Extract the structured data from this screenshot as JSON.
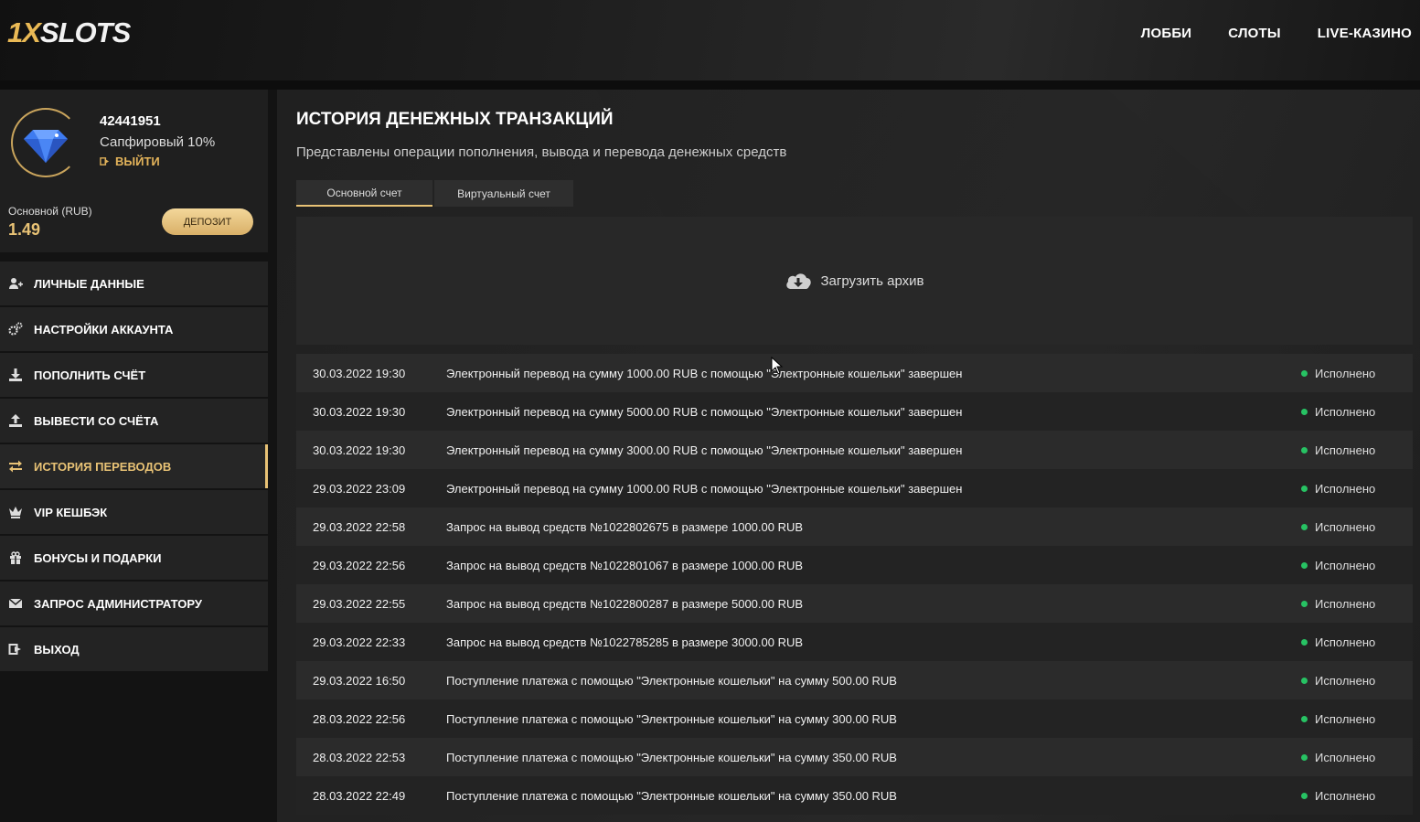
{
  "header": {
    "logo_part1": "1X",
    "logo_part2": "SLOTS",
    "nav": [
      "ЛОББИ",
      "СЛОТЫ",
      "LIVE-КАЗИНО"
    ]
  },
  "profile": {
    "user_id": "42441951",
    "level": "Сапфировый 10%",
    "logout": "ВЫЙТИ",
    "balance_label": "Основной (RUB)",
    "balance_value": "1.49",
    "deposit_label": "ДЕПОЗИТ"
  },
  "menu": [
    {
      "label": "ЛИЧНЫЕ ДАННЫЕ",
      "icon": "user-icon"
    },
    {
      "label": "НАСТРОЙКИ АККАУНТА",
      "icon": "gears-icon"
    },
    {
      "label": "ПОПОЛНИТЬ СЧЁТ",
      "icon": "download-icon"
    },
    {
      "label": "ВЫВЕСТИ СО СЧЁТА",
      "icon": "upload-icon"
    },
    {
      "label": "ИСТОРИЯ ПЕРЕВОДОВ",
      "icon": "transfer-icon",
      "active": true
    },
    {
      "label": "VIP КЕШБЭК",
      "icon": "crown-icon"
    },
    {
      "label": "БОНУСЫ И ПОДАРКИ",
      "icon": "gift-icon"
    },
    {
      "label": "ЗАПРОС АДМИНИСТРАТОРУ",
      "icon": "envelope-icon"
    },
    {
      "label": "ВЫХОД",
      "icon": "exit-icon"
    }
  ],
  "main": {
    "title": "ИСТОРИЯ ДЕНЕЖНЫХ ТРАНЗАКЦИЙ",
    "subtitle": "Представлены операции пополнения, вывода и перевода денежных средств",
    "tabs": [
      "Основной счет",
      "Виртуальный счет"
    ],
    "archive_label": "Загрузить архив"
  },
  "transactions": [
    {
      "date": "30.03.2022 19:30",
      "desc": "Электронный перевод на сумму 1000.00 RUB с помощью \"Электронные кошельки\" завершен",
      "status": "Исполнено"
    },
    {
      "date": "30.03.2022 19:30",
      "desc": "Электронный перевод на сумму 5000.00 RUB с помощью \"Электронные кошельки\" завершен",
      "status": "Исполнено"
    },
    {
      "date": "30.03.2022 19:30",
      "desc": "Электронный перевод на сумму 3000.00 RUB с помощью \"Электронные кошельки\" завершен",
      "status": "Исполнено"
    },
    {
      "date": "29.03.2022 23:09",
      "desc": "Электронный перевод на сумму 1000.00 RUB с помощью \"Электронные кошельки\" завершен",
      "status": "Исполнено"
    },
    {
      "date": "29.03.2022 22:58",
      "desc": "Запрос на вывод средств №1022802675 в размере 1000.00 RUB",
      "status": "Исполнено"
    },
    {
      "date": "29.03.2022 22:56",
      "desc": "Запрос на вывод средств №1022801067 в размере 1000.00 RUB",
      "status": "Исполнено"
    },
    {
      "date": "29.03.2022 22:55",
      "desc": "Запрос на вывод средств №1022800287 в размере 5000.00 RUB",
      "status": "Исполнено"
    },
    {
      "date": "29.03.2022 22:33",
      "desc": "Запрос на вывод средств №1022785285 в размере 3000.00 RUB",
      "status": "Исполнено"
    },
    {
      "date": "29.03.2022 16:50",
      "desc": "Поступление платежа с помощью \"Электронные кошельки\" на сумму 500.00 RUB",
      "status": "Исполнено"
    },
    {
      "date": "28.03.2022 22:56",
      "desc": "Поступление платежа с помощью \"Электронные кошельки\" на сумму 300.00 RUB",
      "status": "Исполнено"
    },
    {
      "date": "28.03.2022 22:53",
      "desc": "Поступление платежа с помощью \"Электронные кошельки\" на сумму 350.00 RUB",
      "status": "Исполнено"
    },
    {
      "date": "28.03.2022 22:49",
      "desc": "Поступление платежа с помощью \"Электронные кошельки\" на сумму 350.00 RUB",
      "status": "Исполнено"
    }
  ],
  "colors": {
    "accent_gold": "#e8c275",
    "status_green": "#27c263"
  }
}
